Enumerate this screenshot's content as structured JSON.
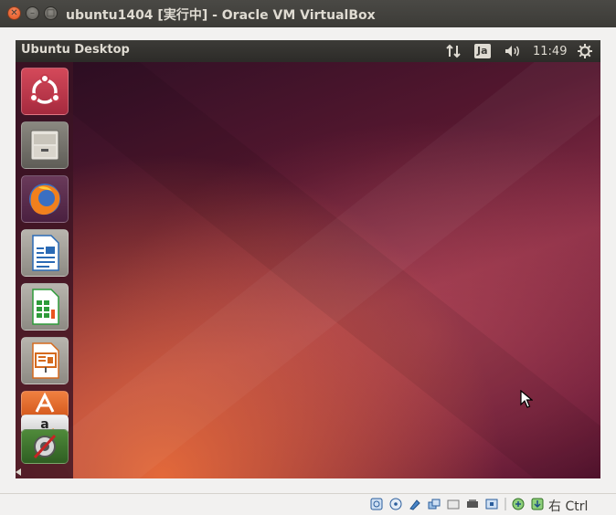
{
  "window": {
    "title": "ubuntu1404 [実行中] - Oracle VM VirtualBox",
    "close_glyph": "✕",
    "min_glyph": "–",
    "max_glyph": "□"
  },
  "guest": {
    "panel": {
      "title": "Ubuntu Desktop",
      "input_method": "Ja",
      "clock": "11:49"
    },
    "launcher": {
      "items": [
        {
          "name": "dash-home",
          "icon": "ubuntu-logo-icon"
        },
        {
          "name": "files",
          "icon": "file-cabinet-icon"
        },
        {
          "name": "firefox",
          "icon": "firefox-icon"
        },
        {
          "name": "libreoffice-writer",
          "icon": "writer-icon"
        },
        {
          "name": "libreoffice-calc",
          "icon": "calc-icon"
        },
        {
          "name": "libreoffice-impress",
          "icon": "impress-icon"
        },
        {
          "name": "ubuntu-software-center",
          "icon": "software-center-icon"
        },
        {
          "name": "amazon",
          "icon": "amazon-icon"
        },
        {
          "name": "system-settings",
          "icon": "settings-icon"
        }
      ]
    }
  },
  "statusbar": {
    "host_key": "右 Ctrl",
    "icons": [
      "hard-disk-icon",
      "optical-disk-icon",
      "usb-icon",
      "shared-folder-icon",
      "display-icon",
      "network-icon",
      "video-capture-icon",
      "cpu-icon",
      "mouse-integration-icon",
      "keyboard-capture-icon"
    ]
  },
  "colors": {
    "ubuntu_orange": "#e95420",
    "panel_bg": "#3c3b37",
    "aubergine": "#5e2750"
  }
}
